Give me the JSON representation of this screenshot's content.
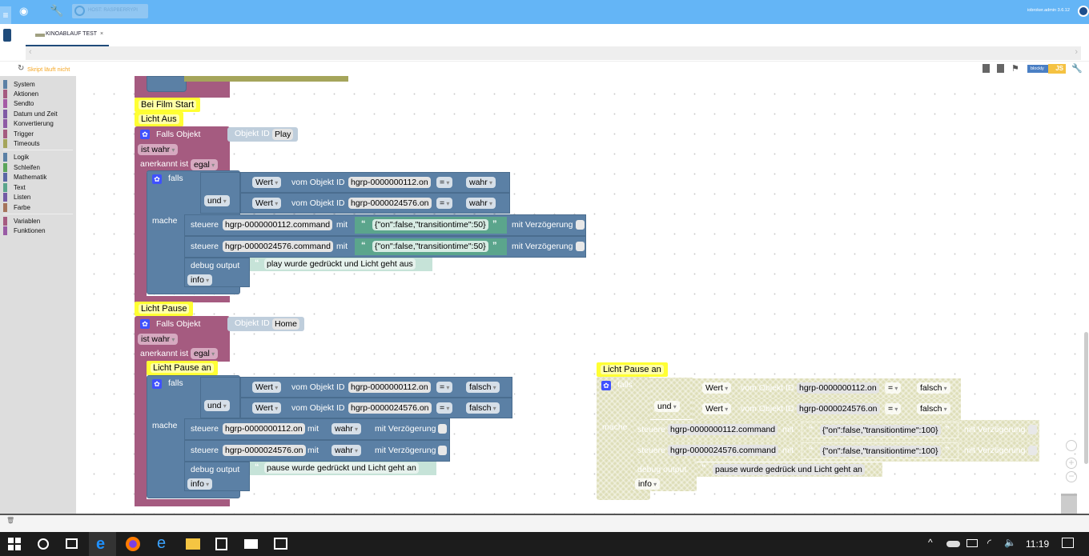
{
  "topbar": {
    "host": "HOST: RASPBERRYPI",
    "user": "iobroker.admin 3.6.12"
  },
  "tab": {
    "label": "KINOABLAUF TEST",
    "close": "×"
  },
  "toolbar": {
    "status": "Skript läuft nicht",
    "mode_blockly": "blockly",
    "mode_js": "JS"
  },
  "toolbox": {
    "groups": [
      [
        "System",
        "Aktionen",
        "Sendto",
        "Datum und Zeit",
        "Konvertierung",
        "Trigger",
        "Timeouts"
      ],
      [
        "Logik",
        "Schleifen",
        "Mathematik",
        "Text",
        "Listen",
        "Farbe"
      ],
      [
        "Variablen",
        "Funktionen"
      ]
    ]
  },
  "colors": {
    "topbar": "#64b5f6",
    "event": "#a55b80",
    "logic": "#5b80a5",
    "text": "#5ba58c",
    "comment": "#ffff33",
    "status": "#f5a623"
  },
  "blocks": {
    "c_start": "Bei Film Start",
    "c_aus": "Licht Aus",
    "c_pause": "Licht Pause",
    "c_pause_an": "Licht Pause an",
    "falls_objekt": "Falls Objekt",
    "objekt_id": "Objekt ID",
    "ist_wahr": "ist wahr",
    "anerkannt": "anerkannt ist",
    "egal": "egal",
    "falls": "falls",
    "und": "und",
    "mache": "mache",
    "wert": "Wert",
    "vom": "vom Objekt ID",
    "eq": "=",
    "steuere": "steuere",
    "mit": "mit",
    "verz": "mit Verzögerung",
    "debug": "debug output",
    "info": "info",
    "obj1": "Play",
    "obj2": "Home",
    "id1on": "hgrp-0000000112.on",
    "id2on": "hgrp-0000024576.on",
    "id1cmd": "hgrp-0000000112.command",
    "id2cmd": "hgrp-0000024576.command",
    "wahr": "wahr",
    "falsch": "falsch",
    "json50": "{\"on\":false,\"transitiontime\":50}",
    "json100": "{\"on\":false,\"transitiontime\":100}",
    "msg1": "play wurde gedrückt und Licht geht aus",
    "msg2": "pause wurde gedrückt und Licht geht an",
    "msg3": "pause wurde gedrück und Licht geht an"
  },
  "taskbar": {
    "time": "11:19"
  }
}
